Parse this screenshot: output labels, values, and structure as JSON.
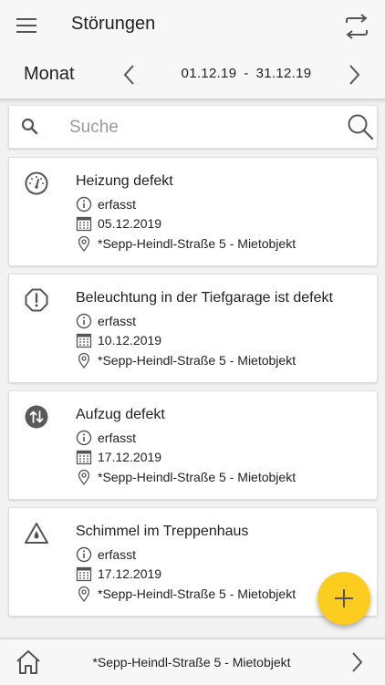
{
  "header": {
    "title": "Störungen",
    "period_label": "Monat",
    "date_from": "01.12.19",
    "date_separator": "-",
    "date_to": "31.12.19"
  },
  "search": {
    "placeholder": "Suche",
    "value": ""
  },
  "incidents": [
    {
      "icon": "gauge-icon",
      "title": "Heizung defekt",
      "status": "erfasst",
      "date": "05.12.2019",
      "location": "*Sepp-Heindl-Straße 5 - Mietobjekt"
    },
    {
      "icon": "alert-octagon-icon",
      "title": "Beleuchtung in der Tiefgarage ist defekt",
      "status": "erfasst",
      "date": "10.12.2019",
      "location": "*Sepp-Heindl-Straße 5 - Mietobjekt"
    },
    {
      "icon": "elevator-icon",
      "title": "Aufzug defekt",
      "status": "erfasst",
      "date": "17.12.2019",
      "location": "*Sepp-Heindl-Straße 5 - Mietobjekt"
    },
    {
      "icon": "water-warning-icon",
      "title": "Schimmel im Treppenhaus",
      "status": "erfasst",
      "date": "17.12.2019",
      "location": "*Sepp-Heindl-Straße 5 - Mietobjekt"
    }
  ],
  "footer": {
    "property_label": "*Sepp-Heindl-Straße 5 - Mietobjekt"
  },
  "colors": {
    "accent": "#fccc1e",
    "icon": "#555555",
    "background": "#f2f2f2"
  }
}
